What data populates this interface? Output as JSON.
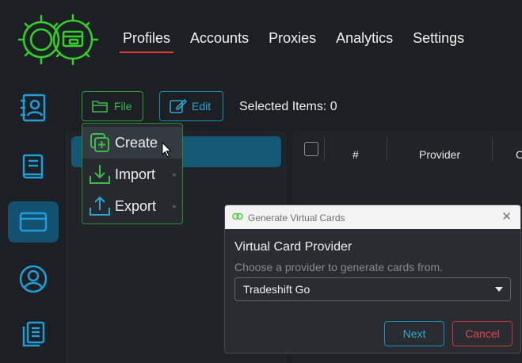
{
  "nav": {
    "items": [
      {
        "label": "Profiles",
        "active": true
      },
      {
        "label": "Accounts"
      },
      {
        "label": "Proxies"
      },
      {
        "label": "Analytics"
      },
      {
        "label": "Settings"
      }
    ]
  },
  "sidebar": {
    "icons": [
      "contacts-book-icon",
      "book-icon",
      "credit-card-icon",
      "user-circle-icon",
      "documents-icon"
    ],
    "active_index": 2
  },
  "toolbar": {
    "file_label": "File",
    "edit_label": "Edit",
    "selected_text": "Selected Items: 0"
  },
  "file_menu": {
    "items": [
      {
        "label": "Create",
        "icon": "create-icon"
      },
      {
        "label": "Import",
        "icon": "import-icon"
      },
      {
        "label": "Export",
        "icon": "export-icon"
      }
    ]
  },
  "table": {
    "columns": [
      "#",
      "Provider",
      "C"
    ]
  },
  "modal": {
    "title": "Generate Virtual Cards",
    "heading": "Virtual Card Provider",
    "subtitle": "Choose a provider to generate cards from.",
    "selected_provider": "Tradeshift Go",
    "next_label": "Next",
    "cancel_label": "Cancel"
  },
  "colors": {
    "accent_green": "#3fb950",
    "accent_blue": "#2aa6cf",
    "accent_red": "#e53935",
    "active_bg": "#155876"
  }
}
